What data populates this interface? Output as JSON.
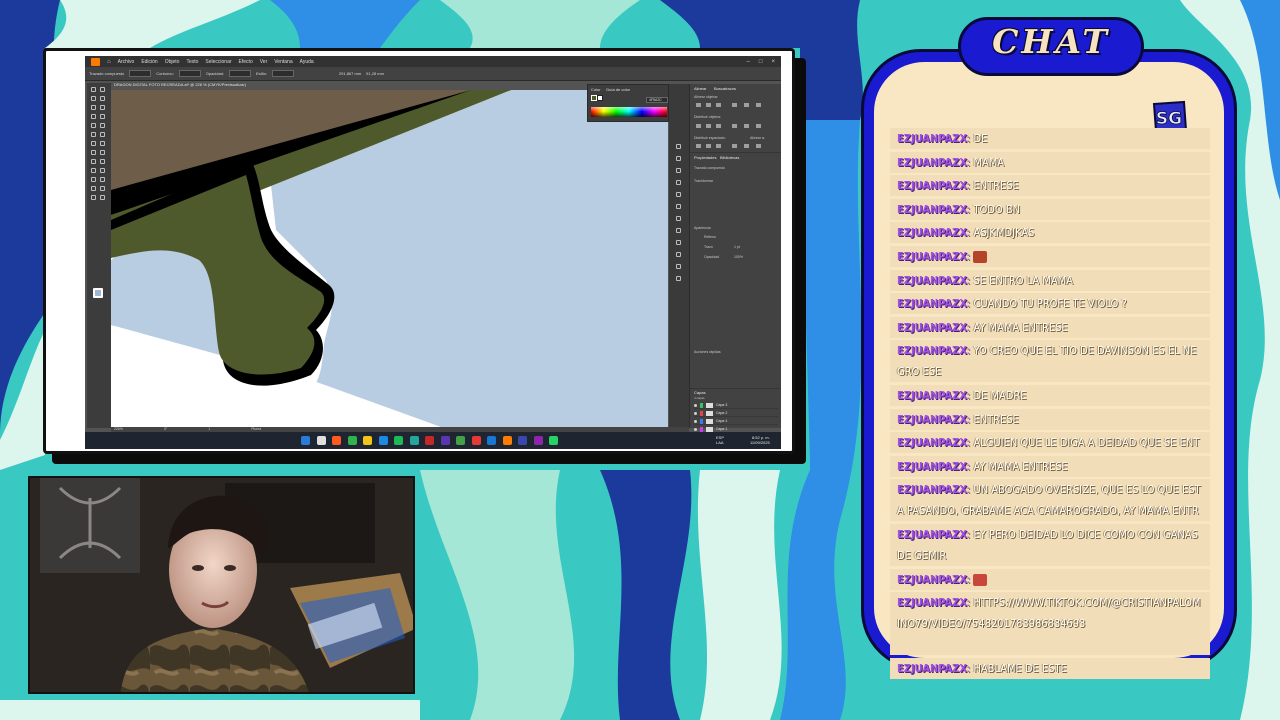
{
  "colors": {
    "wave_navy": "#1b3a9c",
    "wave_blue": "#2f8ee6",
    "wave_teal": "#39c9c2",
    "wave_mint": "#a4e7d6",
    "wave_pale": "#dcf6ee",
    "chat_frame": "#1a1ad1",
    "chat_body": "#f9e6c2",
    "chat_username": "#a352e6",
    "artwork_fill": "#4f5a2c",
    "artwork_brown": "#6e5d49",
    "artwork_sky": "#b9cde2"
  },
  "screen": {
    "menu": [
      "Archivo",
      "Edición",
      "Objeto",
      "Texto",
      "Seleccionar",
      "Efecto",
      "Ver",
      "Ventana",
      "Ayuda"
    ],
    "control_bar": {
      "label": "Trazado compuesto",
      "fill_label": "Contorno:",
      "opacity_label": "Opacidad:",
      "style_label": "Estilo:",
      "width_value": "291,867 mm",
      "height_value": "91,28 mm"
    },
    "doc_tab": "DRAGON DIGITAL FOTO RECREADA.ai* @ 226 % (CMYK/Previsualizar)",
    "color_panel": {
      "tabs": [
        "Color",
        "Guía de color"
      ],
      "hex": "4F5A2C"
    },
    "right_panel": {
      "tabs": [
        "Alinear",
        "Buscatrazos"
      ],
      "align_objects": "Alinear objetos:",
      "distribute_objects": "Distribuir objetos:",
      "distribute_spacing": "Distribuir espaciado:",
      "align_to": "Alinear a:",
      "properties_tabs": [
        "Propiedades",
        "Bibliotecas"
      ],
      "compound_path": "Trazado compuesto",
      "transform": "Transformar",
      "appearance": "Apariencia",
      "fill": "Relleno",
      "stroke": "Trazo",
      "stroke_value": "1 pt",
      "opacity": "Opacidad",
      "opacity_value": "100%",
      "quick_actions": "Acciones rápidas",
      "layers_tab": "Capas",
      "layers": [
        "Capa 3",
        "Capa 2",
        "Capa 4",
        "Capa 1"
      ],
      "layers_count": "4 capas"
    },
    "status": {
      "zoom": "226%",
      "angle": "0°",
      "page": "1",
      "tool": "Pluma"
    },
    "taskbar": {
      "lang_top": "ESP",
      "lang_bottom": "LAA",
      "time": "8:52 p. m.",
      "date": "11/09/2025"
    }
  },
  "chat": {
    "title": "CHAT",
    "logo_text": "SG",
    "messages": [
      {
        "user": "EZJUANPAZX",
        "text": "DE"
      },
      {
        "user": "EZJUANPAZX",
        "text": "MAMA"
      },
      {
        "user": "EZJUANPAZX",
        "text": "ENTRESE"
      },
      {
        "user": "EZJUANPAZX",
        "text": "TODO BN"
      },
      {
        "user": "EZJUANPAZX",
        "text": "ASJKMDJKAS"
      },
      {
        "user": "EZJUANPAZX",
        "text": "",
        "emote": "#b5452a"
      },
      {
        "user": "EZJUANPAZX",
        "text": "SE ENTRO LA MAMA"
      },
      {
        "user": "EZJUANPAZX",
        "text": "CUANDO TU PROFE TE VIOLO ?"
      },
      {
        "user": "EZJUANPAZX",
        "text": "AY MAMA ENTRESE"
      },
      {
        "user": "EZJUANPAZX",
        "text": "YO CREO QUE EL TIO DE DAVINSON ES EL NEGRO ESE"
      },
      {
        "user": "EZJUANPAZX",
        "text": "DE MADRE"
      },
      {
        "user": "EZJUANPAZX",
        "text": "ENTRESE"
      },
      {
        "user": "EZJUANPAZX",
        "text": "ALGUIEN QUE LE DIGA A DEIDAD QUE SE ENTRE"
      },
      {
        "user": "EZJUANPAZX",
        "text": "AY MAMA ENTRESE"
      },
      {
        "user": "EZJUANPAZX",
        "text": "UN ABOGADO OVERSIZE, QUE ES LO QUE ESTA PASANDO, GRABAME ACA CAMAROGRADO, AY MAMA ENTRESE"
      },
      {
        "user": "EZJUANPAZX",
        "text": "EY PERO DEIDAD LO DICE COMO CON GANAS DE GEMIR"
      },
      {
        "user": "EZJUANPAZX",
        "text": "",
        "emote": "#c8463c"
      },
      {
        "user": "EZJUANPAZX",
        "text": "HTTPS://WWW.TIKTOK.COM/@CRISTIANPALOMINO79/VIDEO/7548201783986834693"
      },
      {
        "user": "EZJUANPAZX",
        "text": "HABLAME DE ESTE"
      }
    ]
  }
}
